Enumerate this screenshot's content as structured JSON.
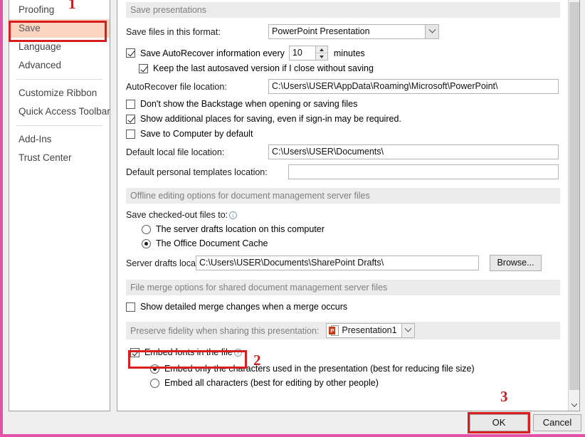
{
  "sidebar": {
    "items": [
      {
        "label": "Proofing",
        "selected": false
      },
      {
        "label": "Save",
        "selected": true
      },
      {
        "label": "Language",
        "selected": false
      },
      {
        "label": "Advanced",
        "selected": false
      },
      {
        "label": "Customize Ribbon",
        "selected": false
      },
      {
        "label": "Quick Access Toolbar",
        "selected": false
      },
      {
        "label": "Add-Ins",
        "selected": false
      },
      {
        "label": "Trust Center",
        "selected": false
      }
    ]
  },
  "sections": {
    "save_presentations": {
      "heading": "Save presentations",
      "save_format_label": "Save files in this format:",
      "save_format_value": "PowerPoint Presentation",
      "autorecover_label": "Save AutoRecover information every",
      "autorecover_minutes": "10",
      "minutes_label": "minutes",
      "keep_last_label": "Keep the last autosaved version if I close without saving",
      "autorecover_loc_label": "AutoRecover file location:",
      "autorecover_loc_value": "C:\\Users\\USER\\AppData\\Roaming\\Microsoft\\PowerPoint\\",
      "dont_show_backstage_label": "Don't show the Backstage when opening or saving files",
      "show_additional_label": "Show additional places for saving, even if sign-in may be required.",
      "save_to_computer_label": "Save to Computer by default",
      "default_local_label": "Default local file location:",
      "default_local_value": "C:\\Users\\USER\\Documents\\",
      "default_templates_label": "Default personal templates location:",
      "default_templates_value": ""
    },
    "offline_editing": {
      "heading": "Offline editing options for document management server files",
      "save_checked_out_label": "Save checked-out files to:",
      "radio_server_drafts": "The server drafts location on this computer",
      "radio_office_cache": "The Office Document Cache",
      "server_drafts_label": "Server drafts location:",
      "server_drafts_value": "C:\\Users\\USER\\Documents\\SharePoint Drafts\\",
      "browse_label": "Browse..."
    },
    "file_merge": {
      "heading": "File merge options for shared document management server files",
      "show_detailed_label": "Show detailed merge changes when a merge occurs"
    },
    "preserve_fidelity": {
      "heading": "Preserve fidelity when sharing this presentation:",
      "presentation_value": "Presentation1",
      "embed_fonts_label": "Embed fonts in the file",
      "radio_embed_used": "Embed only the characters used in the presentation (best for reducing file size)",
      "radio_embed_all": "Embed all characters (best for editing by other people)"
    }
  },
  "footer": {
    "ok_label": "OK",
    "cancel_label": "Cancel"
  },
  "annotations": {
    "step1": "1",
    "step2": "2",
    "step3": "3",
    "color": "#d81f20"
  },
  "icons": {
    "info": "i",
    "pp_badge": "P"
  }
}
